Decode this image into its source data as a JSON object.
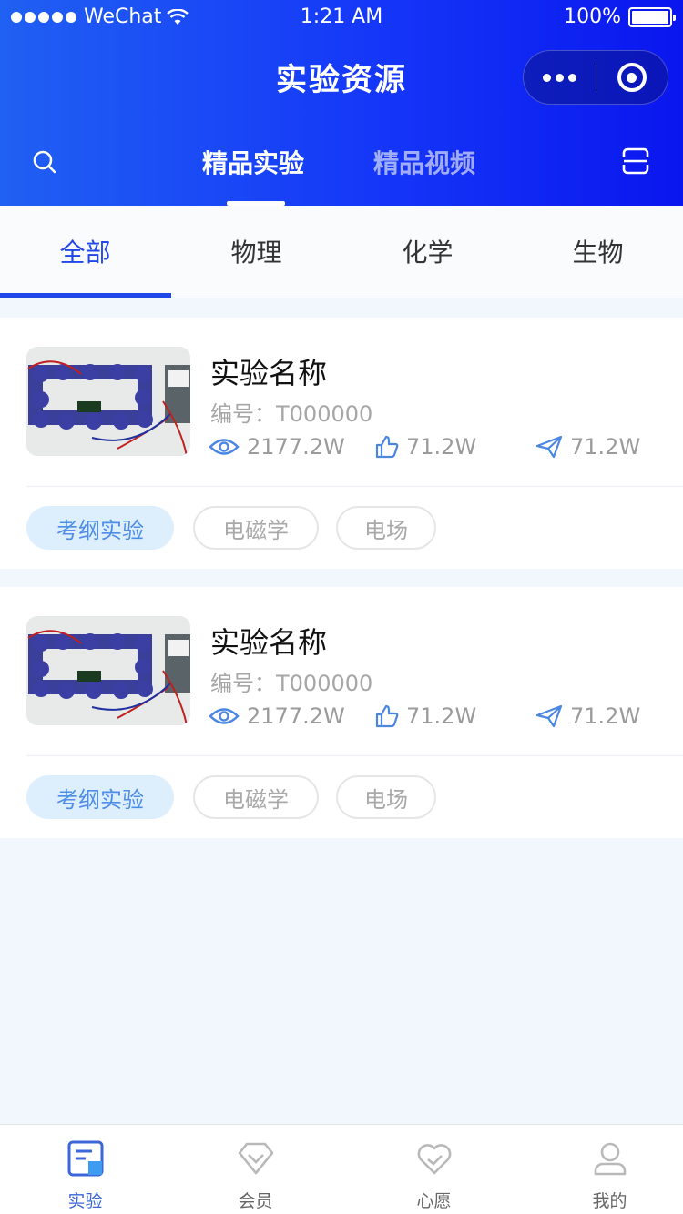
{
  "status_bar": {
    "carrier": "WeChat",
    "time": "1:21 AM",
    "battery": "100%"
  },
  "nav": {
    "title": "实验资源"
  },
  "top_tabs": [
    {
      "label": "精品实验"
    },
    {
      "label": "精品视频"
    }
  ],
  "categories": [
    {
      "label": "全部"
    },
    {
      "label": "物理"
    },
    {
      "label": "化学"
    },
    {
      "label": "生物"
    }
  ],
  "cards": [
    {
      "title": "实验名称",
      "code": "编号：T000000",
      "views": "2177.2W",
      "likes": "71.2W",
      "shares": "71.2W",
      "tags": [
        "考纲实验",
        "电磁学",
        "电场"
      ]
    },
    {
      "title": "实验名称",
      "code": "编号：T000000",
      "views": "2177.2W",
      "likes": "71.2W",
      "shares": "71.2W",
      "tags": [
        "考纲实验",
        "电磁学",
        "电场"
      ]
    }
  ],
  "tabbar": [
    {
      "label": "实验"
    },
    {
      "label": "会员"
    },
    {
      "label": "心愿"
    },
    {
      "label": "我的"
    }
  ],
  "colors": {
    "header_start": "#2060f2",
    "header_end": "#0a16ee",
    "accent": "#2047e8",
    "tag_primary_bg": "#ddeefd",
    "icon_blue": "#4a86e2"
  },
  "icons": [
    "search-icon",
    "scan-icon",
    "more-icon",
    "target-icon",
    "eye-icon",
    "thumb-up-icon",
    "send-icon",
    "experiment-icon",
    "diamond-icon",
    "heart-icon",
    "person-icon"
  ]
}
